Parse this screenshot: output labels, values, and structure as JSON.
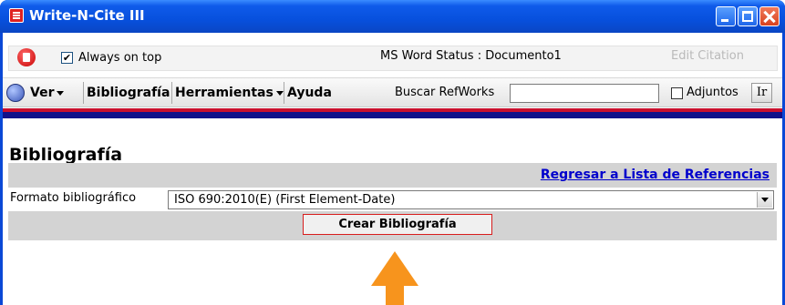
{
  "window": {
    "title": "Write-N-Cite III"
  },
  "statusbar": {
    "always_on_top_label": "Always on top",
    "always_on_top_checked": true,
    "word_status": "MS Word Status : Documento1",
    "edit_citation": "Edit Citation"
  },
  "menu": {
    "ver": "Ver",
    "bibliografia": "Bibliografía",
    "herramientas": "Herramientas",
    "ayuda": "Ayuda",
    "search_label": "Buscar RefWorks",
    "search_value": "",
    "adjuntos_label": "Adjuntos",
    "go_label": "Ir"
  },
  "main": {
    "heading": "Bibliografía",
    "back_link": "Regresar a Lista de Referencias",
    "format_label": "Formato bibliográfico",
    "format_value": "ISO 690:2010(E) (First Element-Date)",
    "create_button": "Crear Bibliografía"
  },
  "colors": {
    "accent_red": "#c8102e",
    "accent_blue": "#11118a",
    "arrow": "#f7941d",
    "link": "#0000cc"
  }
}
